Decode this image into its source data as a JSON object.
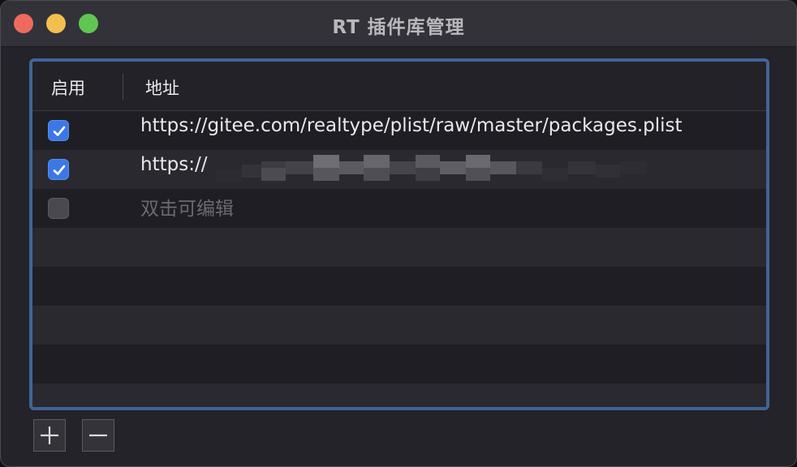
{
  "window": {
    "title": "RT 插件库管理"
  },
  "table": {
    "columns": {
      "enabled": "启用",
      "address": "地址"
    },
    "rows": [
      {
        "enabled": true,
        "address": "https://gitee.com/realtype/plist/raw/master/packages.plist",
        "is_placeholder": false
      },
      {
        "enabled": true,
        "address": "https://",
        "is_placeholder": false,
        "redacted": true
      },
      {
        "enabled": false,
        "address": "双击可编辑",
        "is_placeholder": true
      }
    ]
  },
  "toolbar": {
    "add_icon": "plus-icon",
    "remove_icon": "minus-icon"
  },
  "colors": {
    "accent": "#3b78e6",
    "focus_ring": "#3f6594",
    "close": "#ee6a5e",
    "minimize": "#f4bf4f",
    "maximize": "#61c554"
  }
}
